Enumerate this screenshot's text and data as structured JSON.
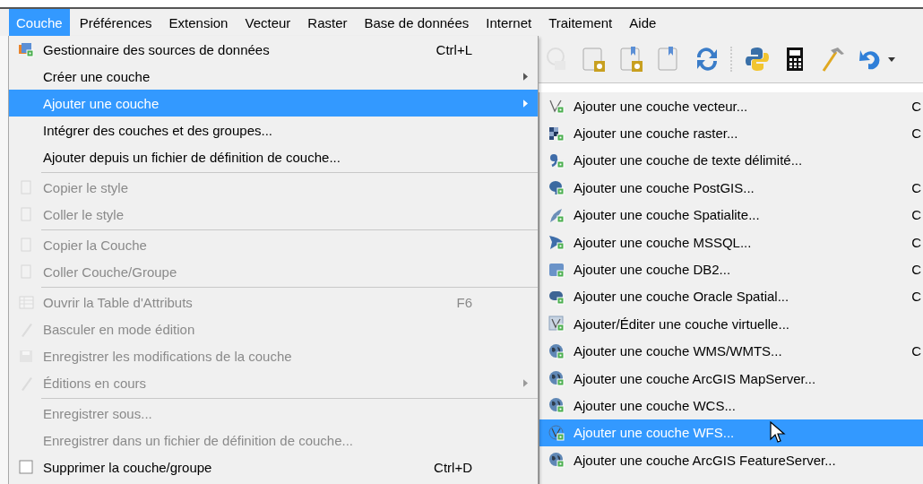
{
  "menubar": [
    {
      "label": "Couche",
      "selected": true
    },
    {
      "label": "Préférences",
      "selected": false
    },
    {
      "label": "Extension",
      "selected": false
    },
    {
      "label": "Vecteur",
      "selected": false
    },
    {
      "label": "Raster",
      "selected": false
    },
    {
      "label": "Base de données",
      "selected": false
    },
    {
      "label": "Internet",
      "selected": false
    },
    {
      "label": "Traitement",
      "selected": false
    },
    {
      "label": "Aide",
      "selected": false
    }
  ],
  "menu": {
    "items": [
      {
        "kind": "item",
        "label": "Gestionnaire des sources de données",
        "shortcut": "Ctrl+L",
        "disabled": false,
        "selected": false,
        "has_submenu": false
      },
      {
        "kind": "item",
        "label": "Créer une couche",
        "disabled": false,
        "selected": false,
        "has_submenu": true
      },
      {
        "kind": "item",
        "label": "Ajouter une couche",
        "disabled": false,
        "selected": true,
        "has_submenu": true
      },
      {
        "kind": "item",
        "label": "Intégrer des couches et des groupes...",
        "disabled": false,
        "selected": false,
        "has_submenu": false
      },
      {
        "kind": "item",
        "label": "Ajouter depuis un fichier de définition de couche...",
        "disabled": false,
        "selected": false,
        "has_submenu": false
      },
      {
        "kind": "separator"
      },
      {
        "kind": "item",
        "label": "Copier le style",
        "disabled": true,
        "selected": false,
        "has_submenu": false
      },
      {
        "kind": "item",
        "label": "Coller le style",
        "disabled": true,
        "selected": false,
        "has_submenu": false
      },
      {
        "kind": "separator"
      },
      {
        "kind": "item",
        "label": "Copier la Couche",
        "disabled": true,
        "selected": false,
        "has_submenu": false
      },
      {
        "kind": "item",
        "label": "Coller Couche/Groupe",
        "disabled": true,
        "selected": false,
        "has_submenu": false
      },
      {
        "kind": "separator"
      },
      {
        "kind": "item",
        "label": "Ouvrir la Table d'Attributs",
        "shortcut": "F6",
        "disabled": true,
        "selected": false,
        "has_submenu": false
      },
      {
        "kind": "item",
        "label": "Basculer en mode édition",
        "disabled": true,
        "selected": false,
        "has_submenu": false
      },
      {
        "kind": "item",
        "label": "Enregistrer les modifications de la couche",
        "disabled": true,
        "selected": false,
        "has_submenu": false
      },
      {
        "kind": "item",
        "label": "Éditions en cours",
        "disabled": true,
        "selected": false,
        "has_submenu": true
      },
      {
        "kind": "separator"
      },
      {
        "kind": "item",
        "label": "Enregistrer sous...",
        "disabled": true,
        "selected": false,
        "has_submenu": false
      },
      {
        "kind": "item",
        "label": "Enregistrer dans un fichier de définition de couche...",
        "disabled": true,
        "selected": false,
        "has_submenu": false
      },
      {
        "kind": "item",
        "label": "Supprimer la couche/groupe",
        "shortcut": "Ctrl+D",
        "disabled": false,
        "selected": false,
        "has_submenu": false
      }
    ]
  },
  "submenu": {
    "items": [
      {
        "label": "Ajouter une couche vecteur...",
        "shortcut": "C",
        "selected": false
      },
      {
        "label": "Ajouter une couche raster...",
        "shortcut": "C",
        "selected": false
      },
      {
        "label": "Ajouter une couche de texte délimité...",
        "selected": false
      },
      {
        "label": "Ajouter une couche PostGIS...",
        "shortcut": "C",
        "selected": false
      },
      {
        "label": "Ajouter une couche Spatialite...",
        "shortcut": "C",
        "selected": false
      },
      {
        "label": "Ajouter une couche MSSQL...",
        "shortcut": "C",
        "selected": false
      },
      {
        "label": "Ajouter une couche DB2...",
        "shortcut": "C",
        "selected": false
      },
      {
        "label": "Ajouter une couche Oracle Spatial...",
        "shortcut": "C",
        "selected": false
      },
      {
        "label": "Ajouter/Éditer une couche virtuelle...",
        "selected": false
      },
      {
        "label": "Ajouter une couche WMS/WMTS...",
        "shortcut": "C",
        "selected": false
      },
      {
        "label": "Ajouter une couche ArcGIS MapServer...",
        "selected": false
      },
      {
        "label": "Ajouter une couche WCS...",
        "selected": false
      },
      {
        "label": "Ajouter une couche WFS...",
        "selected": true
      },
      {
        "label": "Ajouter une couche ArcGIS FeatureServer...",
        "selected": false
      }
    ]
  }
}
